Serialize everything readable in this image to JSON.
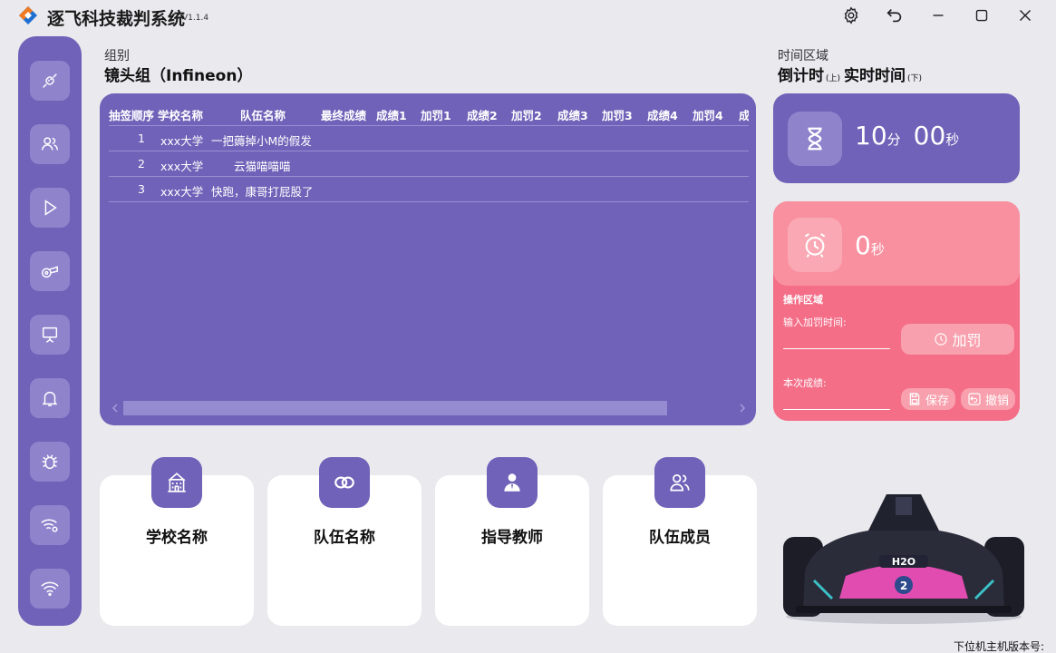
{
  "app": {
    "title": "逐飞科技裁判系统",
    "version": "V1.1.4"
  },
  "window_controls": [
    "gear-icon",
    "undo-icon",
    "minimize-icon",
    "maximize-icon",
    "close-icon"
  ],
  "sidebar": {
    "items": [
      "connect-icon",
      "users-icon",
      "play-icon",
      "whistle-icon",
      "presentation-icon",
      "bell-icon",
      "bug-icon",
      "wifi-settings-icon",
      "wifi-icon"
    ]
  },
  "group": {
    "label": "组别",
    "name": "镜头组（Infineon）"
  },
  "table": {
    "columns": [
      "抽签顺序",
      "学校名称",
      "队伍名称",
      "最终成绩",
      "成绩1",
      "加罚1",
      "成绩2",
      "加罚2",
      "成绩3",
      "加罚3",
      "成绩4",
      "加罚4",
      "成"
    ],
    "rows": [
      {
        "order": "1",
        "school": "xxx大学",
        "team": "一把薅掉小M的假发"
      },
      {
        "order": "2",
        "school": "xxx大学",
        "team": "云猫喵喵喵"
      },
      {
        "order": "3",
        "school": "xxx大学",
        "team": "快跑，康哥打屁股了"
      }
    ]
  },
  "info_cards": [
    "学校名称",
    "队伍名称",
    "指导教师",
    "队伍成员"
  ],
  "time_area": {
    "label": "时间区域",
    "mode_countdown": "倒计时",
    "mode_countdown_hint": "(上)",
    "mode_realtime": "实时时间",
    "mode_realtime_hint": "(下)"
  },
  "countdown": {
    "minutes": "10",
    "minutes_unit": "分",
    "seconds": "00",
    "seconds_unit": "秒"
  },
  "realtime": {
    "seconds": "0",
    "seconds_unit": "秒"
  },
  "operation": {
    "title": "操作区域",
    "penalty_label": "输入加罚时间:",
    "penalty_button": "加罚",
    "score_label": "本次成绩:",
    "save_button": "保存",
    "undo_button": "撤销"
  },
  "footer": {
    "version_label": "下位机主机版本号:"
  },
  "colors": {
    "purple": "#6f62b8",
    "purple_light": "#8f84cc",
    "pink": "#f46e88",
    "pink_light": "#f8909f"
  }
}
